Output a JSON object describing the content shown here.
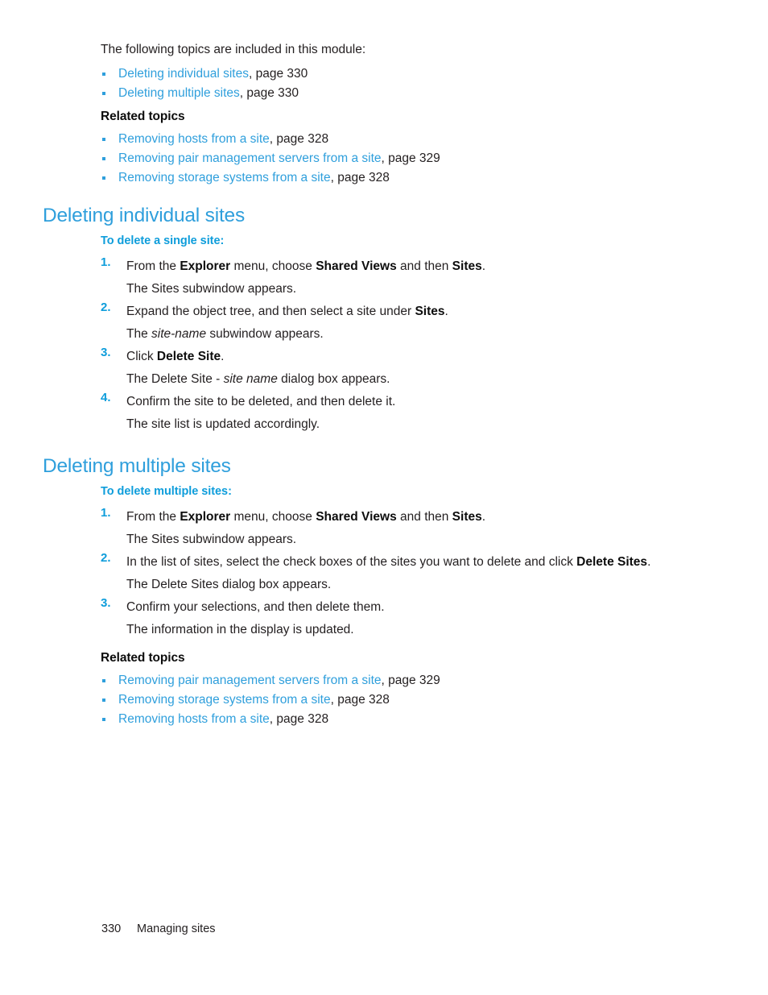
{
  "intro": {
    "text": "The following topics are included in this module:"
  },
  "module_topics": [
    {
      "link": "Deleting individual sites",
      "page_ref": ", page 330"
    },
    {
      "link": "Deleting multiple sites",
      "page_ref": ", page 330"
    }
  ],
  "related_topics_top": {
    "heading": "Related topics",
    "items": [
      {
        "link": "Removing hosts from a site",
        "page_ref": ", page 328"
      },
      {
        "link": "Removing pair management servers from a site",
        "page_ref": ", page 329"
      },
      {
        "link": "Removing storage systems from a site",
        "page_ref": ", page 328"
      }
    ]
  },
  "section_individual": {
    "title": "Deleting individual sites",
    "sub_heading": "To delete a single site:",
    "steps": [
      {
        "num": "1.",
        "text_parts": [
          {
            "t": "From the ",
            "s": "plain"
          },
          {
            "t": "Explorer",
            "s": "bold"
          },
          {
            "t": " menu, choose ",
            "s": "plain"
          },
          {
            "t": "Shared Views",
            "s": "bold"
          },
          {
            "t": " and then ",
            "s": "plain"
          },
          {
            "t": "Sites",
            "s": "bold"
          },
          {
            "t": ".",
            "s": "plain"
          }
        ],
        "result_parts": [
          {
            "t": "The Sites subwindow appears.",
            "s": "plain"
          }
        ]
      },
      {
        "num": "2.",
        "text_parts": [
          {
            "t": "Expand the object tree, and then select a site under ",
            "s": "plain"
          },
          {
            "t": "Sites",
            "s": "bold"
          },
          {
            "t": ".",
            "s": "plain"
          }
        ],
        "result_parts": [
          {
            "t": "The ",
            "s": "plain"
          },
          {
            "t": "site-name",
            "s": "italic"
          },
          {
            "t": " subwindow appears.",
            "s": "plain"
          }
        ]
      },
      {
        "num": "3.",
        "text_parts": [
          {
            "t": "Click ",
            "s": "plain"
          },
          {
            "t": "Delete Site",
            "s": "bold"
          },
          {
            "t": ".",
            "s": "plain"
          }
        ],
        "result_parts": [
          {
            "t": "The Delete Site - ",
            "s": "plain"
          },
          {
            "t": "site name",
            "s": "italic"
          },
          {
            "t": " dialog box appears.",
            "s": "plain"
          }
        ]
      },
      {
        "num": "4.",
        "text_parts": [
          {
            "t": "Confirm the site to be deleted, and then delete it.",
            "s": "plain"
          }
        ],
        "result_parts": [
          {
            "t": "The site list is updated accordingly.",
            "s": "plain"
          }
        ]
      }
    ]
  },
  "section_multiple": {
    "title": "Deleting multiple sites",
    "sub_heading": "To delete multiple sites:",
    "steps": [
      {
        "num": "1.",
        "text_parts": [
          {
            "t": "From the ",
            "s": "plain"
          },
          {
            "t": "Explorer",
            "s": "bold"
          },
          {
            "t": " menu, choose ",
            "s": "plain"
          },
          {
            "t": "Shared Views",
            "s": "bold"
          },
          {
            "t": " and then ",
            "s": "plain"
          },
          {
            "t": "Sites",
            "s": "bold"
          },
          {
            "t": ".",
            "s": "plain"
          }
        ],
        "result_parts": [
          {
            "t": "The Sites subwindow appears.",
            "s": "plain"
          }
        ]
      },
      {
        "num": "2.",
        "text_parts": [
          {
            "t": "In the list of sites, select the check boxes of the sites you want to delete and click ",
            "s": "plain"
          },
          {
            "t": "Delete Sites",
            "s": "bold"
          },
          {
            "t": ".",
            "s": "plain"
          }
        ],
        "result_parts": [
          {
            "t": "The Delete Sites dialog box appears.",
            "s": "plain"
          }
        ]
      },
      {
        "num": "3.",
        "text_parts": [
          {
            "t": "Confirm your selections, and then delete them.",
            "s": "plain"
          }
        ],
        "result_parts": [
          {
            "t": "The information in the display is updated.",
            "s": "plain"
          }
        ]
      }
    ]
  },
  "related_topics_bottom": {
    "heading": "Related topics",
    "items": [
      {
        "link": "Removing pair management servers from a site",
        "page_ref": ", page 329"
      },
      {
        "link": "Removing storage systems from a site",
        "page_ref": ", page 328"
      },
      {
        "link": "Removing hosts from a site",
        "page_ref": ", page 328"
      }
    ]
  },
  "footer": {
    "page_number": "330",
    "chapter": "Managing sites"
  },
  "colors": {
    "link": "#2f9fdc",
    "heading": "#2f9fdc",
    "subheading": "#0e9ddb",
    "body": "#231f20",
    "background": "#ffffff"
  }
}
